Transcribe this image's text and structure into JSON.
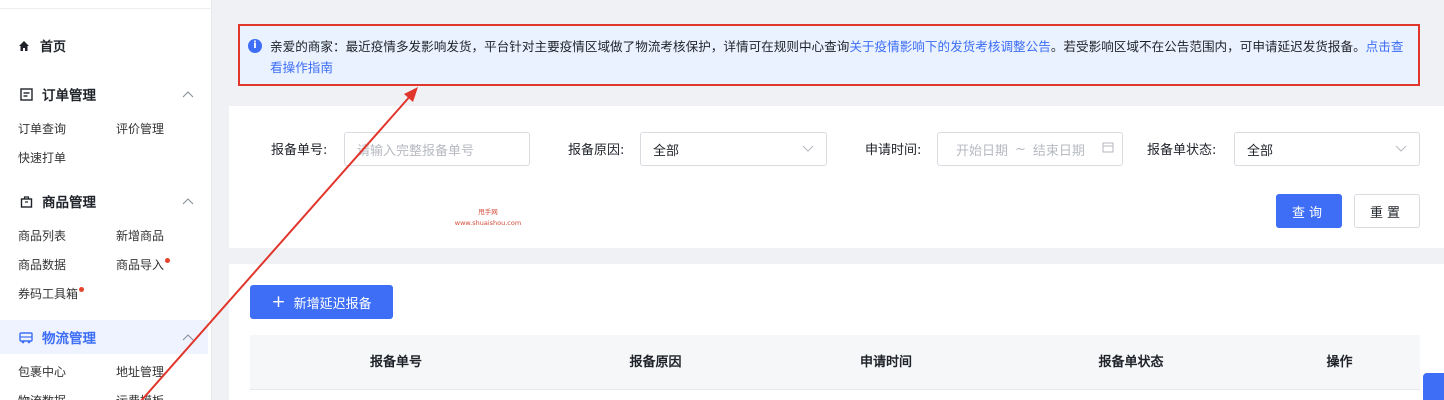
{
  "sidebar": {
    "home": {
      "label": "首页",
      "icon": "home-icon"
    },
    "sections": [
      {
        "title": "订单管理",
        "icon": "order-icon",
        "items": [
          {
            "label": "订单查询"
          },
          {
            "label": "评价管理"
          },
          {
            "label": "快速打单"
          }
        ]
      },
      {
        "title": "商品管理",
        "icon": "bag-icon",
        "items": [
          {
            "label": "商品列表"
          },
          {
            "label": "新增商品"
          },
          {
            "label": "商品数据"
          },
          {
            "label": "商品导入",
            "dot": true
          },
          {
            "label": "券码工具箱",
            "dot": true
          }
        ]
      },
      {
        "title": "物流管理",
        "icon": "truck-icon",
        "active": true,
        "items": [
          {
            "label": "包裹中心"
          },
          {
            "label": "地址管理"
          },
          {
            "label": "物流数据"
          },
          {
            "label": "运费模板"
          }
        ]
      }
    ]
  },
  "notice": {
    "text_1": "亲爱的商家：最近疫情多发影响发货，平台针对主要疫情区域做了物流考核保护，详情可在规则中心查询",
    "link_1": "关于疫情影响下的发货考核调整公告",
    "text_2": "。若受影响区域不在公告范围内，可申请延迟发货报备。",
    "link_2": "点击查看操作指南"
  },
  "filter": {
    "report_no_label": "报备单号:",
    "report_no_placeholder": "请输入完整报备单号",
    "reason_label": "报备原因:",
    "reason_value": "全部",
    "time_label": "申请时间:",
    "time_start_placeholder": "开始日期",
    "time_separator": "~",
    "time_end_placeholder": "结束日期",
    "status_label": "报备单状态:",
    "status_value": "全部",
    "search_button": "查询",
    "reset_button": "重置"
  },
  "watermark": {
    "line1": "甩手网",
    "line2": "www.shuaishou.com"
  },
  "table": {
    "add_button": "新增延迟报备",
    "columns": [
      "报备单号",
      "报备原因",
      "申请时间",
      "报备单状态",
      "操作"
    ]
  },
  "colors": {
    "accent": "#3d6ef5",
    "annotation_red": "#e0362c"
  }
}
